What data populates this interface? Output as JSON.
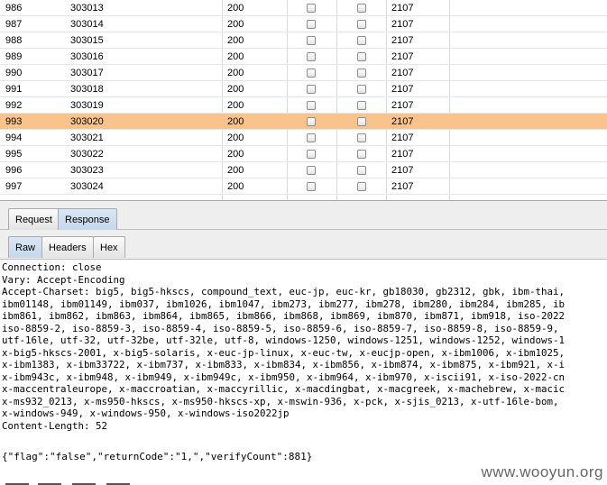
{
  "table": {
    "rows": [
      {
        "num": "986",
        "payload": "303013",
        "status": "200",
        "length": "2107",
        "selected": false
      },
      {
        "num": "987",
        "payload": "303014",
        "status": "200",
        "length": "2107",
        "selected": false
      },
      {
        "num": "988",
        "payload": "303015",
        "status": "200",
        "length": "2107",
        "selected": false
      },
      {
        "num": "989",
        "payload": "303016",
        "status": "200",
        "length": "2107",
        "selected": false
      },
      {
        "num": "990",
        "payload": "303017",
        "status": "200",
        "length": "2107",
        "selected": false
      },
      {
        "num": "991",
        "payload": "303018",
        "status": "200",
        "length": "2107",
        "selected": false
      },
      {
        "num": "992",
        "payload": "303019",
        "status": "200",
        "length": "2107",
        "selected": false
      },
      {
        "num": "993",
        "payload": "303020",
        "status": "200",
        "length": "2107",
        "selected": true
      },
      {
        "num": "994",
        "payload": "303021",
        "status": "200",
        "length": "2107",
        "selected": false
      },
      {
        "num": "995",
        "payload": "303022",
        "status": "200",
        "length": "2107",
        "selected": false
      },
      {
        "num": "996",
        "payload": "303023",
        "status": "200",
        "length": "2107",
        "selected": false
      },
      {
        "num": "997",
        "payload": "303024",
        "status": "200",
        "length": "2107",
        "selected": false
      }
    ],
    "selected_color": "#f9c48b"
  },
  "tabs": {
    "request": "Request",
    "response": "Response"
  },
  "subtabs": {
    "raw": "Raw",
    "headers": "Headers",
    "hex": "Hex"
  },
  "response_lines": [
    "Connection: close",
    "Vary: Accept-Encoding",
    "Accept-Charset: big5, big5-hkscs, compound_text, euc-jp, euc-kr, gb18030, gb2312, gbk, ibm-thai,",
    "ibm01148, ibm01149, ibm037, ibm1026, ibm1047, ibm273, ibm277, ibm278, ibm280, ibm284, ibm285, ib",
    "ibm861, ibm862, ibm863, ibm864, ibm865, ibm866, ibm868, ibm869, ibm870, ibm871, ibm918, iso-2022",
    "iso-8859-2, iso-8859-3, iso-8859-4, iso-8859-5, iso-8859-6, iso-8859-7, iso-8859-8, iso-8859-9,",
    "utf-16le, utf-32, utf-32be, utf-32le, utf-8, windows-1250, windows-1251, windows-1252, windows-1",
    "x-big5-hkscs-2001, x-big5-solaris, x-euc-jp-linux, x-euc-tw, x-eucjp-open, x-ibm1006, x-ibm1025,",
    "x-ibm1383, x-ibm33722, x-ibm737, x-ibm833, x-ibm834, x-ibm856, x-ibm874, x-ibm875, x-ibm921, x-i",
    "x-ibm943c, x-ibm948, x-ibm949, x-ibm949c, x-ibm950, x-ibm964, x-ibm970, x-iscii91, x-iso-2022-cn",
    "x-maccentraleurope, x-maccroatian, x-maccyrillic, x-macdingbat, x-macgreek, x-machebrew, x-macic",
    "x-ms932_0213, x-ms950-hkscs, x-ms950-hkscs-xp, x-mswin-936, x-pck, x-sjis_0213, x-utf-16le-bom,",
    "x-windows-949, x-windows-950, x-windows-iso2022jp",
    "Content-Length: 52"
  ],
  "json_body": "{\"flag\":\"false\",\"returnCode\":\"1,\",\"verifyCount\":881}",
  "watermark": "www.wooyun.org"
}
